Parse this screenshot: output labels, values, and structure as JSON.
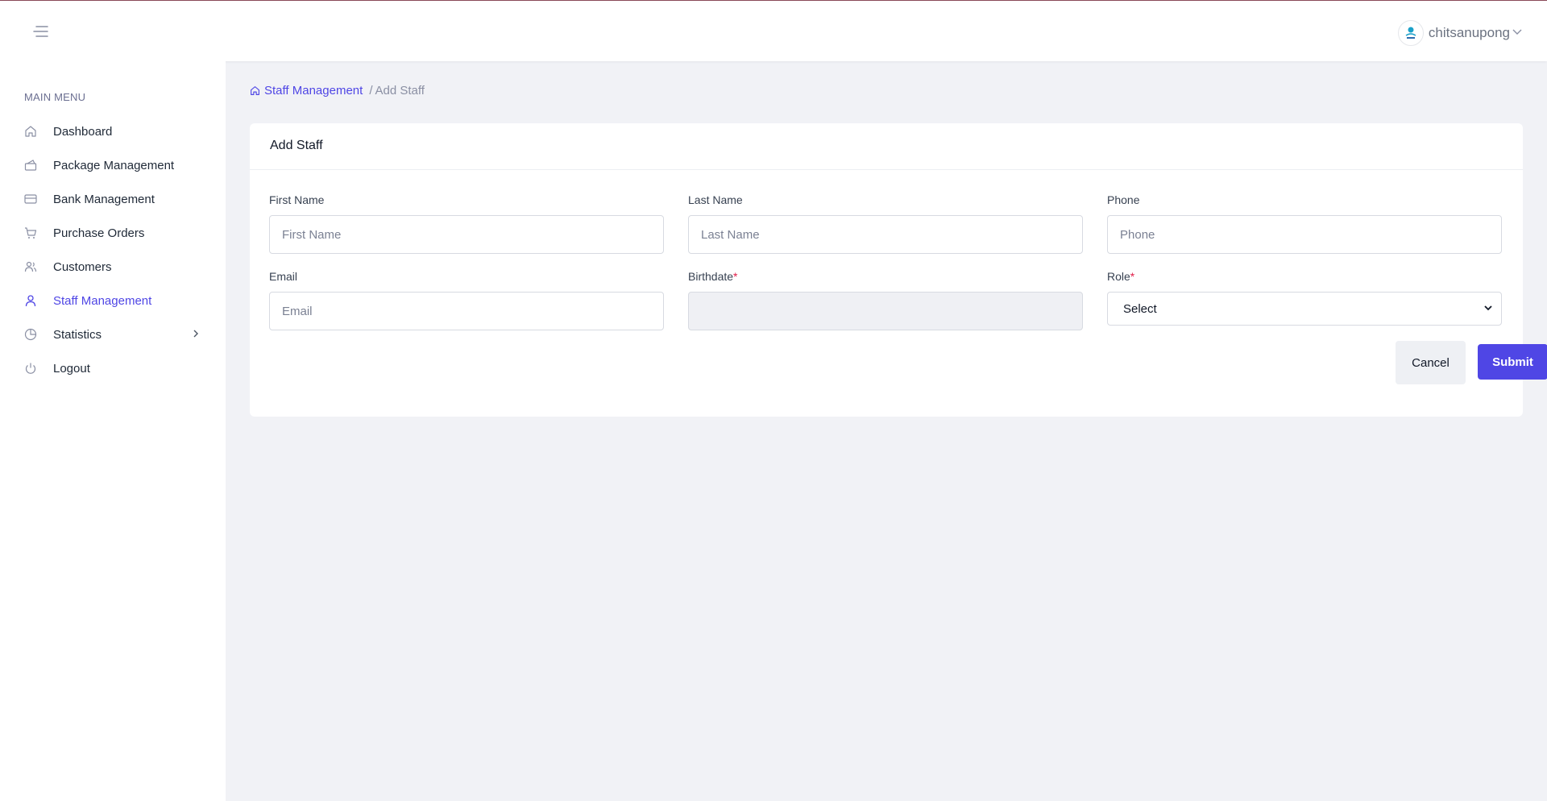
{
  "header": {
    "username": "chitsanupong"
  },
  "sidebar": {
    "section_title": "MAIN MENU",
    "items": [
      {
        "label": "Dashboard",
        "icon": "home-icon"
      },
      {
        "label": "Package Management",
        "icon": "package-icon"
      },
      {
        "label": "Bank Management",
        "icon": "credit-card-icon"
      },
      {
        "label": "Purchase Orders",
        "icon": "cart-icon"
      },
      {
        "label": "Customers",
        "icon": "users-icon"
      },
      {
        "label": "Staff Management",
        "icon": "user-icon",
        "active": true
      },
      {
        "label": "Statistics",
        "icon": "pie-chart-icon",
        "has_submenu": true
      },
      {
        "label": "Logout",
        "icon": "power-icon"
      }
    ]
  },
  "breadcrumb": {
    "parent": "Staff Management",
    "separator": "/",
    "current": "Add Staff"
  },
  "form": {
    "title": "Add Staff",
    "first_name": {
      "label": "First Name",
      "placeholder": "First Name",
      "value": ""
    },
    "last_name": {
      "label": "Last Name",
      "placeholder": "Last Name",
      "value": ""
    },
    "phone": {
      "label": "Phone",
      "placeholder": "Phone",
      "value": ""
    },
    "email": {
      "label": "Email",
      "placeholder": "Email",
      "value": ""
    },
    "birthdate": {
      "label": "Birthdate",
      "required_mark": "*",
      "value": ""
    },
    "role": {
      "label": "Role",
      "required_mark": "*",
      "selected": "Select"
    },
    "cancel_label": "Cancel",
    "submit_label": "Submit"
  },
  "colors": {
    "accent": "#4f46e5",
    "background": "#f1f2f6",
    "required": "#e11d48"
  }
}
